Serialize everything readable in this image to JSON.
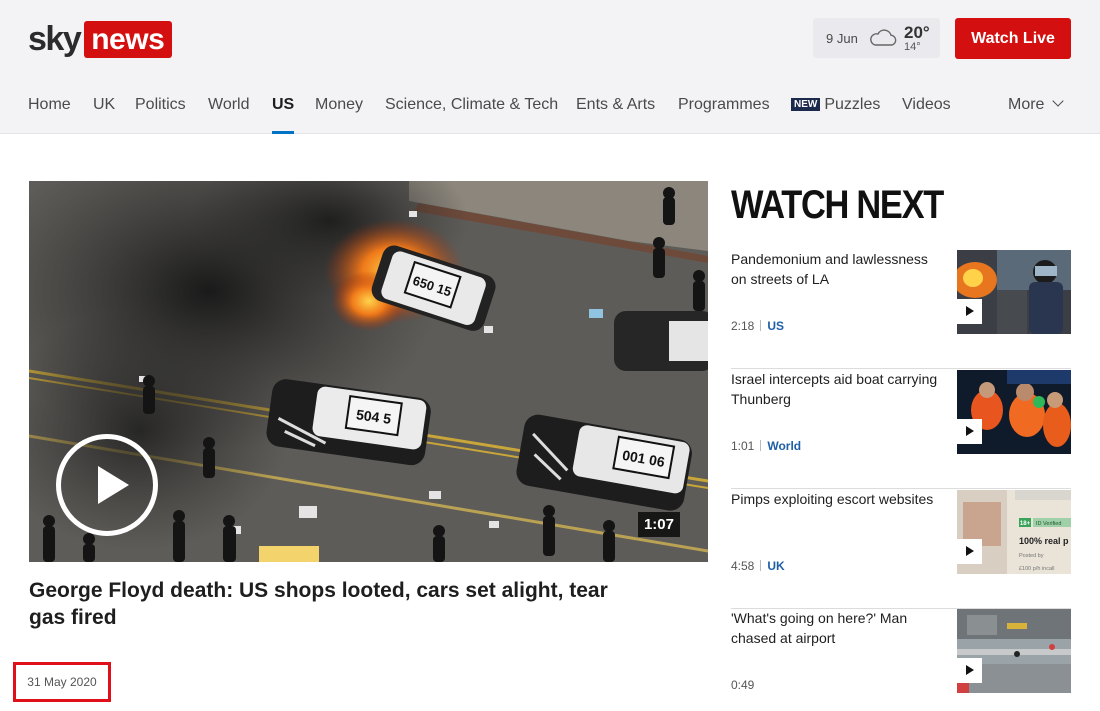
{
  "header": {
    "logo_sky": "sky",
    "logo_news": "news",
    "weather": {
      "date": "9 Jun",
      "high": "20°",
      "low": "14°",
      "icon": "cloud-icon"
    },
    "watch_live_label": "Watch Live",
    "nav": [
      {
        "label": "Home"
      },
      {
        "label": "UK"
      },
      {
        "label": "Politics"
      },
      {
        "label": "World"
      },
      {
        "label": "US",
        "active": true
      },
      {
        "label": "Money"
      },
      {
        "label": "Science, Climate & Tech"
      },
      {
        "label": "Ents & Arts"
      },
      {
        "label": "Programmes"
      },
      {
        "label": "Puzzles",
        "badge": "NEW"
      },
      {
        "label": "Videos"
      },
      {
        "label": "More"
      }
    ]
  },
  "hero": {
    "title": "George Floyd death: US shops looted, cars set alight, tear gas fired",
    "date": "31 May 2020",
    "duration": "1:07",
    "car_plates": [
      "650 15",
      "504 5",
      "001 06"
    ]
  },
  "watch_next": {
    "heading": "WATCH NEXT",
    "items": [
      {
        "headline": "Pandemonium and lawlessness on streets of LA",
        "duration": "2:18",
        "category": "US"
      },
      {
        "headline": "Israel intercepts aid boat carrying Thunberg",
        "duration": "1:01",
        "category": "World"
      },
      {
        "headline": "Pimps exploiting escort websites",
        "duration": "4:58",
        "category": "UK",
        "thumb_text": [
          "18+",
          "ID Verified",
          "100% real p",
          "Posted by",
          "£100 p/h incall"
        ]
      },
      {
        "headline": "'What's going on here?' Man chased at airport",
        "duration": "0:49",
        "category": ""
      }
    ]
  },
  "colors": {
    "brand_red": "#d40f0f",
    "nav_active_underline": "#0073c5",
    "category_link": "#1f5fa8",
    "date_highlight_box": "#e0101a"
  }
}
